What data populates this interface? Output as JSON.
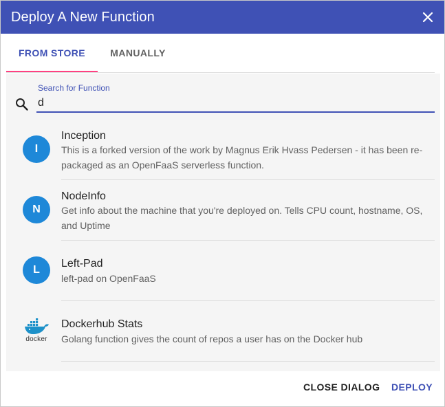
{
  "dialog": {
    "title": "Deploy A New Function",
    "close_icon": "close-icon"
  },
  "tabs": [
    {
      "label": "FROM STORE",
      "active": true
    },
    {
      "label": "MANUALLY",
      "active": false
    }
  ],
  "search": {
    "label": "Search for Function",
    "value": "d",
    "icon": "search-icon"
  },
  "functions": [
    {
      "avatar": "I",
      "name": "Inception",
      "description": "This is a forked version of the work by Magnus Erik Hvass Pedersen - it has been re-packaged as an OpenFaaS serverless function."
    },
    {
      "avatar": "N",
      "name": "NodeInfo",
      "description": "Get info about the machine that you're deployed on. Tells CPU count, hostname, OS, and Uptime"
    },
    {
      "avatar": "L",
      "name": "Left-Pad",
      "description": "left-pad on OpenFaaS"
    },
    {
      "avatar": "docker-logo",
      "avatar_text": "docker",
      "name": "Dockerhub Stats",
      "description": "Golang function gives the count of repos a user has on the Docker hub"
    }
  ],
  "actions": {
    "close_label": "CLOSE DIALOG",
    "deploy_label": "DEPLOY"
  },
  "colors": {
    "primary": "#3f51b5",
    "accent": "#ff4081",
    "avatar": "#1e88d8"
  }
}
